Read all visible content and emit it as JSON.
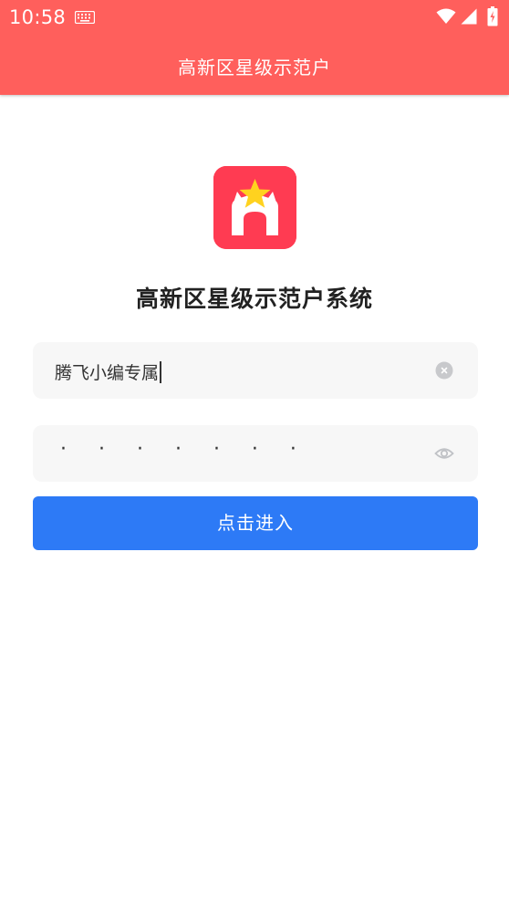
{
  "status_bar": {
    "time": "10:58",
    "icons": [
      "keyboard-icon",
      "wifi-icon",
      "signal-icon",
      "battery-icon"
    ]
  },
  "header": {
    "title": "高新区星级示范户"
  },
  "logo": {
    "icon": "star-house-icon",
    "background_color": "#ff3b52",
    "star_color": "#ffd21f"
  },
  "main": {
    "system_title": "高新区星级示范户系统",
    "username_value": "腾飞小编专属",
    "password_mask": "· · · · · · ·",
    "submit_label": "点击进入"
  },
  "colors": {
    "header": "#ff5f5c",
    "button": "#2d7af6",
    "field_bg": "#f7f7f7"
  }
}
